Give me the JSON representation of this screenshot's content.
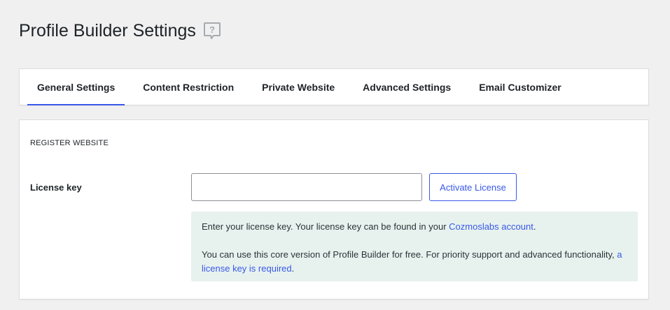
{
  "header": {
    "title": "Profile Builder Settings",
    "help_icon": "help-speech-bubble-icon"
  },
  "tabs": [
    {
      "label": "General Settings",
      "active": true
    },
    {
      "label": "Content Restriction",
      "active": false
    },
    {
      "label": "Private Website",
      "active": false
    },
    {
      "label": "Advanced Settings",
      "active": false
    },
    {
      "label": "Email Customizer",
      "active": false
    }
  ],
  "register": {
    "heading": "REGISTER WEBSITE",
    "license_label": "License key",
    "license_value": "",
    "activate_label": "Activate License",
    "notice": {
      "line1_prefix": "Enter your license key. Your license key can be found in your ",
      "line1_link": "Cozmoslabs account",
      "line1_suffix": ".",
      "line2_prefix": "You can use this core version of Profile Builder for free. For priority support and advanced functionality, ",
      "line2_link": "a license key is required",
      "line2_suffix": "."
    }
  },
  "colors": {
    "accent": "#3858e9",
    "notice_bg": "#e7f2ee",
    "page_bg": "#f0f0f1"
  }
}
